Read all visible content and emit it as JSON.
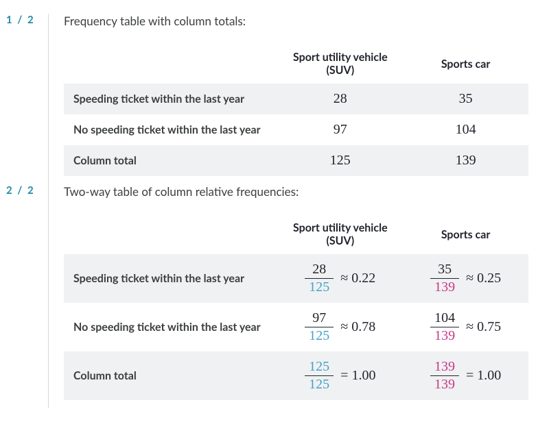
{
  "sections": [
    {
      "badge": "1 / 2",
      "title": "Frequency table with column totals:",
      "headers": [
        "",
        "Sport utility vehicle (SUV)",
        "Sports car"
      ],
      "rows": [
        {
          "label": "Speeding ticket within the last year",
          "c1": "28",
          "c2": "35"
        },
        {
          "label": "No speeding ticket within the last year",
          "c1": "97",
          "c2": "104"
        },
        {
          "label": "Column total",
          "c1": "125",
          "c2": "139"
        }
      ]
    },
    {
      "badge": "2 / 2",
      "title": "Two-way table of column relative frequencies:",
      "headers": [
        "",
        "Sport utility vehicle (SUV)",
        "Sports car"
      ],
      "rows": [
        {
          "label": "Speeding ticket within the last year",
          "c1": {
            "num": "28",
            "den": "125",
            "sym": "≈",
            "val": "0.22"
          },
          "c2": {
            "num": "35",
            "den": "139",
            "sym": "≈",
            "val": "0.25"
          }
        },
        {
          "label": "No speeding ticket within the last year",
          "c1": {
            "num": "97",
            "den": "125",
            "sym": "≈",
            "val": "0.78"
          },
          "c2": {
            "num": "104",
            "den": "139",
            "sym": "≈",
            "val": "0.75"
          }
        },
        {
          "label": "Column total",
          "c1": {
            "num": "125",
            "den": "125",
            "sym": "=",
            "val": "1.00"
          },
          "c2": {
            "num": "139",
            "den": "139",
            "sym": "=",
            "val": "1.00"
          }
        }
      ]
    }
  ]
}
